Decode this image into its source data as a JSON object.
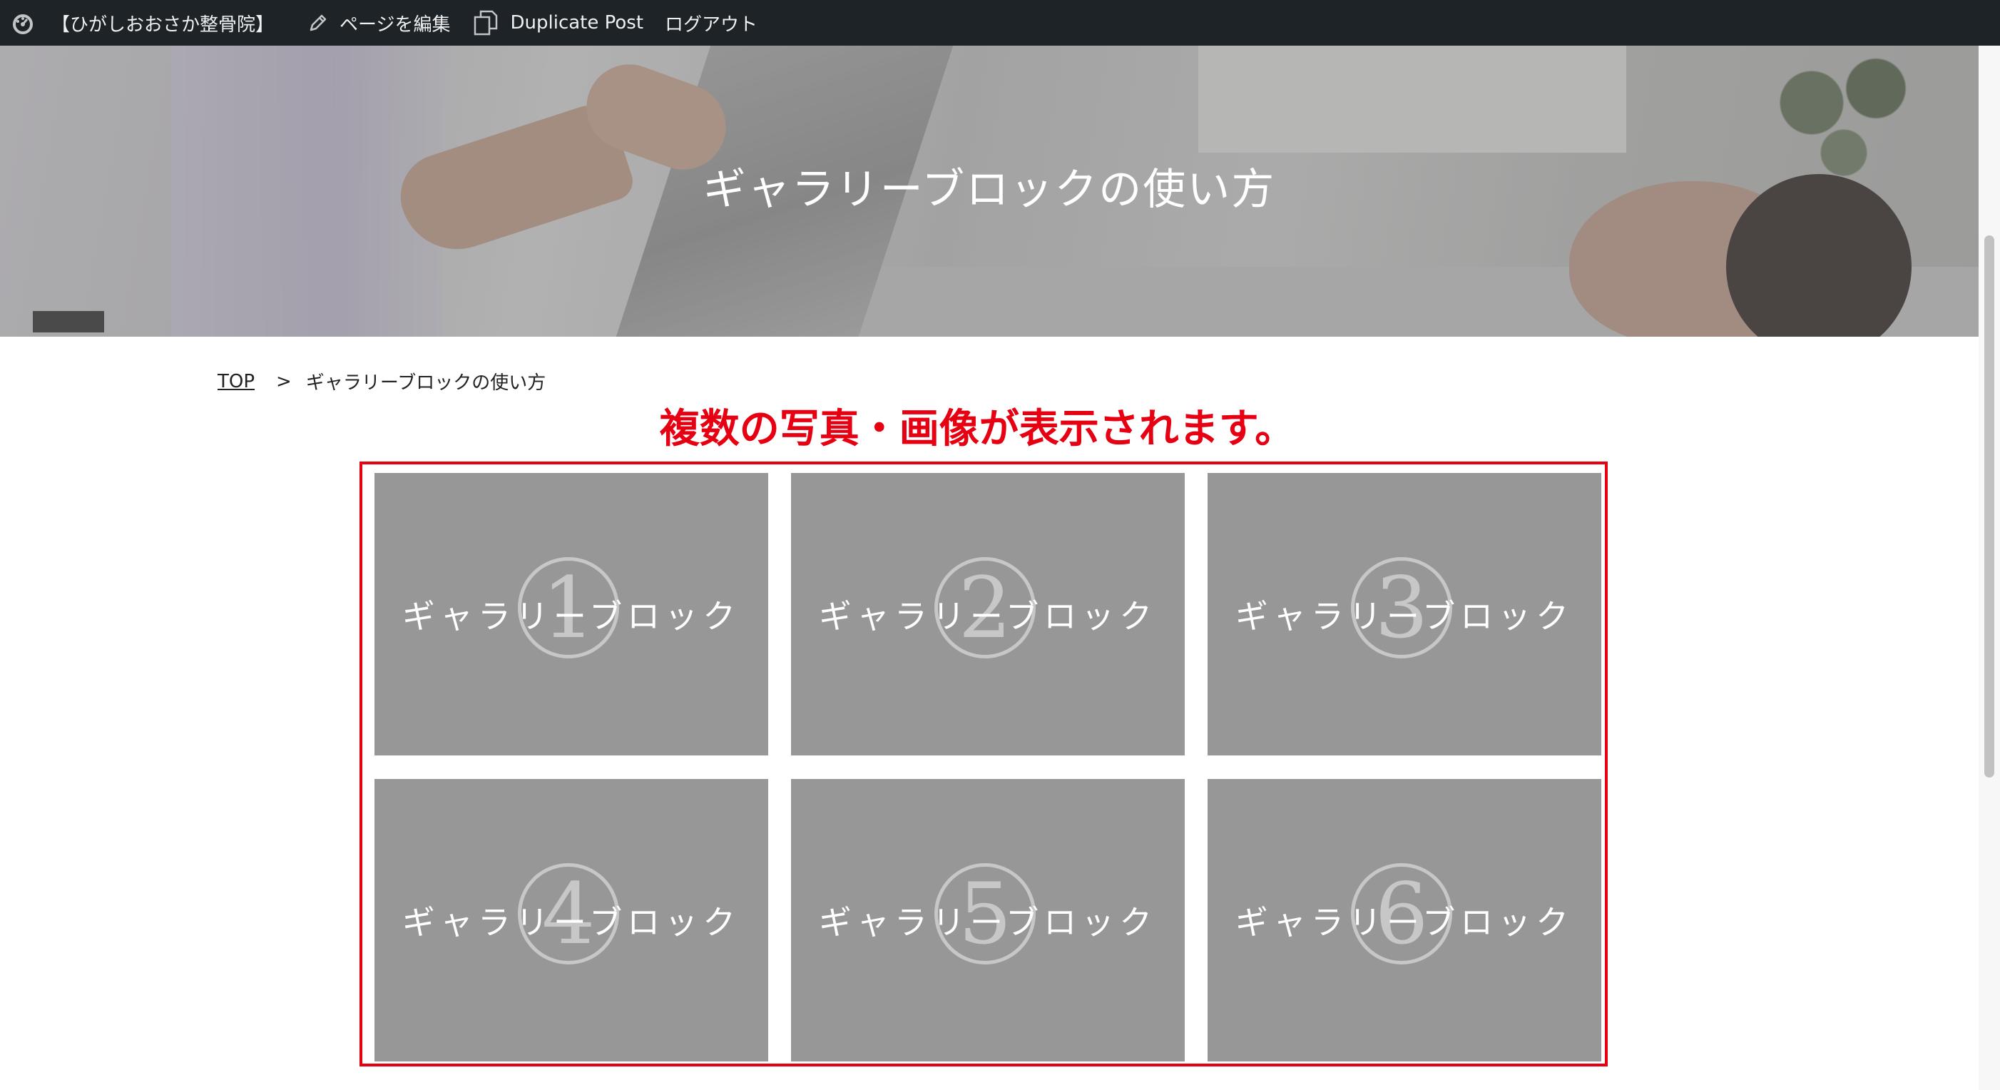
{
  "admin_bar": {
    "site_name": "【ひがしおおさか整骨院】",
    "edit_page": "ページを編集",
    "duplicate_post": "Duplicate Post",
    "logout": "ログアウト"
  },
  "hero": {
    "title": "ギャラリーブロックの使い方"
  },
  "breadcrumb": {
    "home": "TOP",
    "separator": ">",
    "current": "ギャラリーブロックの使い方"
  },
  "annotation": {
    "text": "複数の写真・画像が表示されます。",
    "color": "#e60012"
  },
  "gallery": {
    "items": [
      {
        "number": "1",
        "label": "ギャラリーブロック"
      },
      {
        "number": "2",
        "label": "ギャラリーブロック"
      },
      {
        "number": "3",
        "label": "ギャラリーブロック"
      },
      {
        "number": "4",
        "label": "ギャラリーブロック"
      },
      {
        "number": "5",
        "label": "ギャラリーブロック"
      },
      {
        "number": "6",
        "label": "ギャラリーブロック"
      }
    ]
  },
  "colors": {
    "admin_bar_bg": "#1d2327",
    "tile_bg": "#979797",
    "annotation_red": "#e60012"
  },
  "icons": {
    "admin_logo": "dashboard-icon",
    "edit": "pencil-icon",
    "duplicate": "duplicate-icon"
  }
}
